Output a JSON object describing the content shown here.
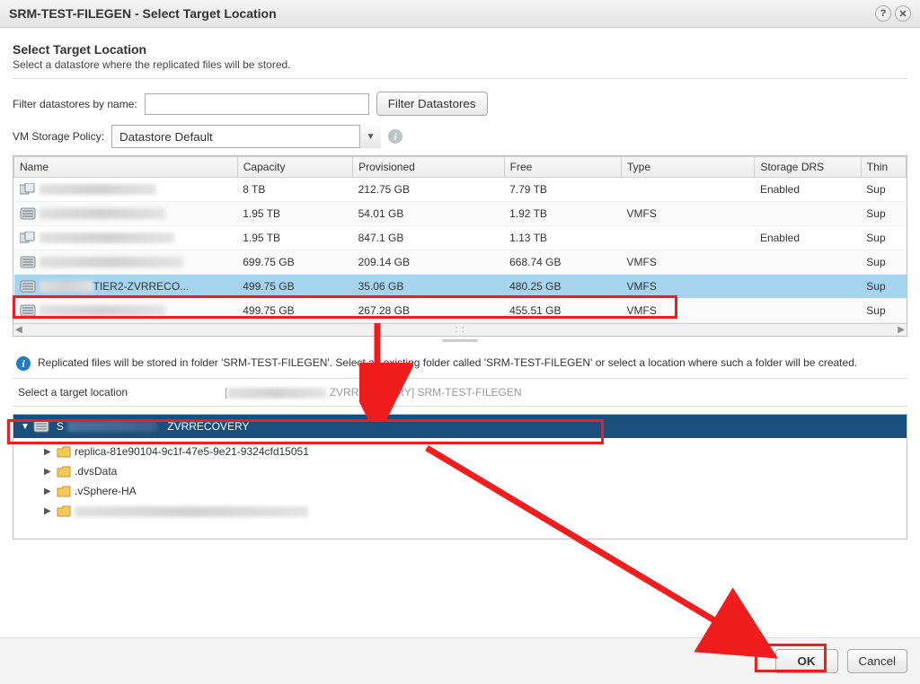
{
  "window": {
    "title": "SRM-TEST-FILEGEN - Select Target Location"
  },
  "header": {
    "title": "Select Target Location",
    "subtitle": "Select a datastore where the replicated files will be stored."
  },
  "filter": {
    "label": "Filter datastores by name:",
    "button": "Filter Datastores"
  },
  "policy": {
    "label": "VM Storage Policy:",
    "selected": "Datastore Default"
  },
  "table": {
    "columns": {
      "name": "Name",
      "capacity": "Capacity",
      "provisioned": "Provisioned",
      "free": "Free",
      "type": "Type",
      "drs": "Storage DRS",
      "thin": "Thin"
    },
    "rows": [
      {
        "name": "",
        "capacity": "8 TB",
        "provisioned": "212.75 GB",
        "free": "7.79 TB",
        "type": "",
        "drs": "Enabled",
        "thin": "Sup",
        "icon": "cluster"
      },
      {
        "name": "",
        "capacity": "1.95 TB",
        "provisioned": "54.01 GB",
        "free": "1.92 TB",
        "type": "VMFS",
        "drs": "",
        "thin": "Sup",
        "icon": "ds"
      },
      {
        "name": "",
        "capacity": "1.95 TB",
        "provisioned": "847.1 GB",
        "free": "1.13 TB",
        "type": "",
        "drs": "Enabled",
        "thin": "Sup",
        "icon": "cluster"
      },
      {
        "name": "",
        "capacity": "699.75 GB",
        "provisioned": "209.14 GB",
        "free": "668.74 GB",
        "type": "VMFS",
        "drs": "",
        "thin": "Sup",
        "icon": "ds"
      },
      {
        "name": "TIER2-ZVRRECO...",
        "capacity": "499.75 GB",
        "provisioned": "35.06 GB",
        "free": "480.25 GB",
        "type": "VMFS",
        "drs": "",
        "thin": "Sup",
        "icon": "ds",
        "selected": true
      },
      {
        "name": "",
        "capacity": "499.75 GB",
        "provisioned": "267.28 GB",
        "free": "455.51 GB",
        "type": "VMFS",
        "drs": "",
        "thin": "Sup",
        "icon": "ds"
      }
    ]
  },
  "info_text": "Replicated files will be stored in folder 'SRM-TEST-FILEGEN'. Select an existing folder called 'SRM-TEST-FILEGEN' or select a location where such a folder will be created.",
  "target": {
    "label": "Select a target location",
    "path_prefix": "[",
    "path_mid": "ZVRRECOVERY] SRM-TEST-FILEGEN"
  },
  "tree": {
    "root_suffix": "ZVRRECOVERY",
    "items": [
      {
        "label": "replica-81e90104-9c1f-47e5-9e21-9324cfd15051"
      },
      {
        "label": ".dvsData"
      },
      {
        "label": ".vSphere-HA"
      },
      {
        "label": ""
      }
    ]
  },
  "buttons": {
    "ok": "OK",
    "cancel": "Cancel"
  }
}
